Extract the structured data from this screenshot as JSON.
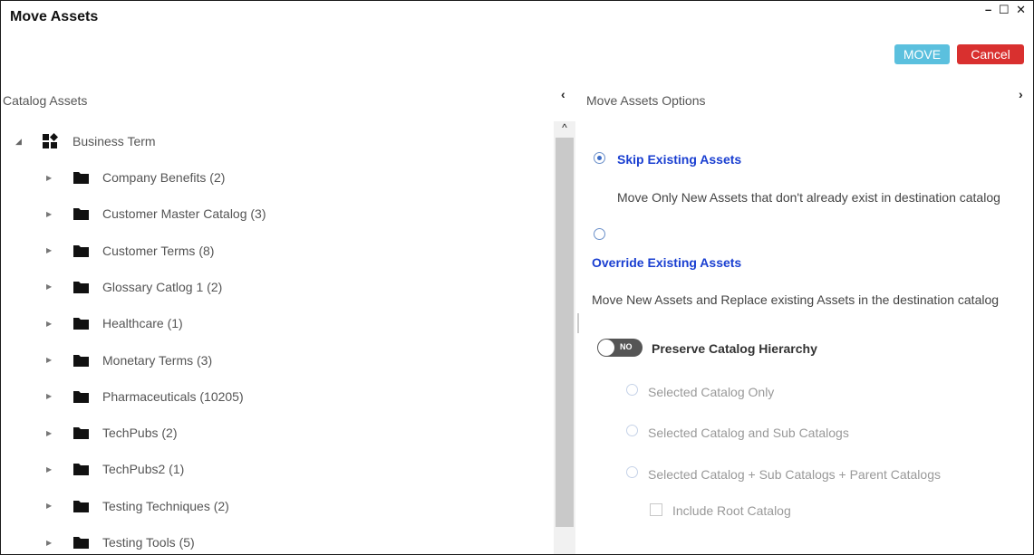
{
  "window": {
    "title": "Move Assets",
    "minimize": "–",
    "maximize": "☐",
    "close": "✕"
  },
  "toolbar": {
    "move_label": "MOVE",
    "cancel_label": "Cancel",
    "move_color": "#5bc0de",
    "cancel_color": "#d9302f"
  },
  "left_panel": {
    "header": "Catalog Assets",
    "collapse_icon": "‹",
    "tree": {
      "root": {
        "label": "Business Term",
        "icon": "business-term-icon",
        "expanded": true
      },
      "children": [
        {
          "label": "Company Benefits (2)"
        },
        {
          "label": "Customer Master Catalog (3)"
        },
        {
          "label": "Customer Terms (8)"
        },
        {
          "label": "Glossary Catlog 1 (2)"
        },
        {
          "label": "Healthcare (1)"
        },
        {
          "label": "Monetary Terms (3)"
        },
        {
          "label": "Pharmaceuticals (10205)"
        },
        {
          "label": "TechPubs (2)"
        },
        {
          "label": "TechPubs2 (1)"
        },
        {
          "label": "Testing Techniques (2)"
        },
        {
          "label": "Testing Tools (5)"
        }
      ]
    }
  },
  "right_panel": {
    "header": "Move Assets Options",
    "collapse_icon": "›",
    "options": [
      {
        "label": "Skip Existing Assets",
        "description": "Move Only New Assets that don't already exist in destination catalog",
        "selected": true
      },
      {
        "label": "Override Existing Assets",
        "description": "Move New Assets and Replace existing Assets in the destination catalog",
        "selected": false
      }
    ],
    "preserve": {
      "toggle_text": "NO",
      "label": "Preserve Catalog Hierarchy",
      "enabled": false,
      "sub_options": [
        {
          "label": "Selected Catalog Only"
        },
        {
          "label": "Selected Catalog and Sub Catalogs"
        },
        {
          "label": "Selected Catalog + Sub Catalogs + Parent Catalogs"
        }
      ],
      "include_root_label": "Include Root Catalog"
    }
  }
}
